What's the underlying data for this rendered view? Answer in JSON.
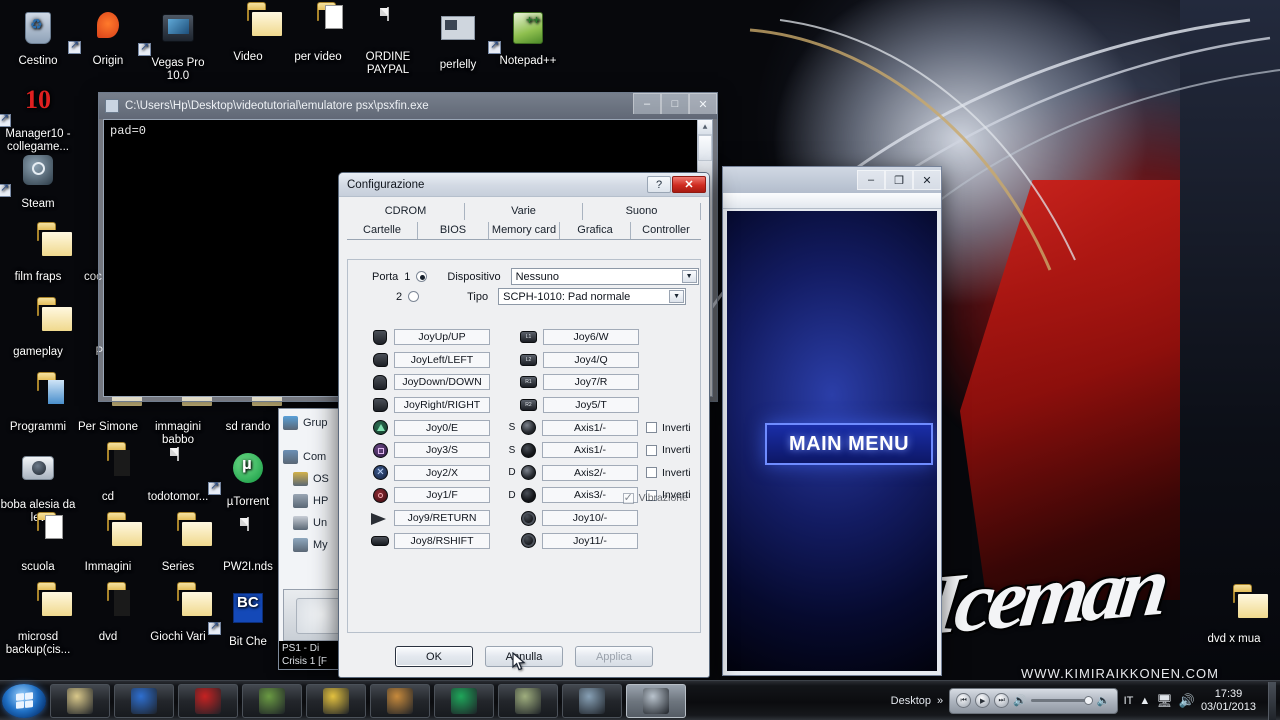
{
  "desktop": {
    "icons": [
      {
        "label": "Cestino",
        "type": "recycle"
      },
      {
        "label": "Origin",
        "type": "origin"
      },
      {
        "label": "Vegas Pro 10.0",
        "type": "vegas"
      },
      {
        "label": "Video",
        "type": "folder"
      },
      {
        "label": "per video",
        "type": "folder-doc"
      },
      {
        "label": "ORDINE PAYPAL",
        "type": "paper"
      },
      {
        "label": "perlelly",
        "type": "image"
      },
      {
        "label": "Notepad++",
        "type": "notepadpp"
      },
      {
        "label": "Manager10 - collegame...",
        "type": "manager10"
      },
      {
        "label": "Steam",
        "type": "steam"
      },
      {
        "label": "film fraps",
        "type": "folder"
      },
      {
        "label": "coc... coll",
        "type": "folder"
      },
      {
        "label": "gameplay",
        "type": "folder"
      },
      {
        "label": "PRO",
        "type": "folder"
      },
      {
        "label": "Programmi",
        "type": "folder-blue"
      },
      {
        "label": "Per Simone",
        "type": "folder"
      },
      {
        "label": "immagini babbo",
        "type": "folder"
      },
      {
        "label": "sd rando",
        "type": "folder"
      },
      {
        "label": "boba alesia da lev",
        "type": "camera"
      },
      {
        "label": "cd",
        "type": "folder-blk"
      },
      {
        "label": "todotomor...",
        "type": "paper"
      },
      {
        "label": "µTorrent",
        "type": "utorrent"
      },
      {
        "label": "scuola",
        "type": "folder-doc"
      },
      {
        "label": "Immagini",
        "type": "folder"
      },
      {
        "label": "Series",
        "type": "folder"
      },
      {
        "label": "PW2I.nds",
        "type": "paper"
      },
      {
        "label": "microsd backup(cis...",
        "type": "folder"
      },
      {
        "label": "dvd",
        "type": "folder-blk"
      },
      {
        "label": "Giochi Vari",
        "type": "folder"
      },
      {
        "label": "Bit Che",
        "type": "bitche"
      },
      {
        "label": "dvd x mua",
        "type": "folder"
      }
    ]
  },
  "wallpaper": {
    "brand_script": "Iceman",
    "url_text": "WWW.KIMIRAIKKONEN.COM"
  },
  "console_window": {
    "title": "C:\\Users\\Hp\\Desktop\\videotutorial\\emulatore psx\\psxfin.exe",
    "output": "pad=0",
    "minimize_label": "–",
    "maximize_label": "□",
    "close_label": "✕"
  },
  "explorer_window": {
    "items": [
      {
        "label": "Grup"
      },
      {
        "label": "Com"
      },
      {
        "label": "OS"
      },
      {
        "label": "HP"
      },
      {
        "label": "Un"
      },
      {
        "label": "My"
      }
    ],
    "caption_line1": "PS1 - Di",
    "caption_line2": "Crisis 1 [F"
  },
  "game_window": {
    "minimize_label": "–",
    "maximize_label": "❐",
    "close_label": "✕",
    "main_menu_text": "MAIN MENU"
  },
  "config_dialog": {
    "title": "Configurazione",
    "help_label": "?",
    "close_label": "✕",
    "tabs_row1": [
      "CDROM",
      "Varie",
      "Suono"
    ],
    "tabs_row2": [
      "Cartelle",
      "BIOS",
      "Memory card",
      "Grafica",
      "Controller"
    ],
    "active_tab": "Controller",
    "port": {
      "label": "Porta",
      "option1": "1",
      "option2": "2",
      "selected": "1"
    },
    "device": {
      "label": "Dispositivo",
      "value": "Nessuno"
    },
    "type": {
      "label": "Tipo",
      "value": "SCPH-1010: Pad normale"
    },
    "bindings_left": [
      {
        "icon": "dpad-up-icon",
        "value": "JoyUp/UP"
      },
      {
        "icon": "dpad-left-icon",
        "value": "JoyLeft/LEFT"
      },
      {
        "icon": "dpad-down-icon",
        "value": "JoyDown/DOWN"
      },
      {
        "icon": "dpad-right-icon",
        "value": "JoyRight/RIGHT"
      },
      {
        "icon": "triangle-icon",
        "value": "Joy0/E"
      },
      {
        "icon": "square-icon",
        "value": "Joy3/S"
      },
      {
        "icon": "cross-icon",
        "value": "Joy2/X"
      },
      {
        "icon": "circle-icon",
        "value": "Joy1/F"
      },
      {
        "icon": "start-icon",
        "value": "Joy9/RETURN"
      },
      {
        "icon": "select-icon",
        "value": "Joy8/RSHIFT"
      }
    ],
    "bindings_right": [
      {
        "icon": "l1-icon",
        "value": "Joy6/W",
        "prefix": "",
        "invert": null
      },
      {
        "icon": "l2-icon",
        "value": "Joy4/Q",
        "prefix": "",
        "invert": null
      },
      {
        "icon": "r1-icon",
        "value": "Joy7/R",
        "prefix": "",
        "invert": null
      },
      {
        "icon": "r2-icon",
        "value": "Joy5/T",
        "prefix": "",
        "invert": null
      },
      {
        "icon": "stick-light-icon",
        "value": "Axis1/-",
        "prefix": "S",
        "invert": false,
        "invert_label": "Inverti"
      },
      {
        "icon": "stick-dark-icon",
        "value": "Axis1/-",
        "prefix": "S",
        "invert": false,
        "invert_label": "Inverti"
      },
      {
        "icon": "stick-light-icon",
        "value": "Axis2/-",
        "prefix": "D",
        "invert": false,
        "invert_label": "Inverti"
      },
      {
        "icon": "stick-dark-icon",
        "value": "Axis3/-",
        "prefix": "D",
        "invert": false,
        "invert_label": "Inverti"
      },
      {
        "icon": "l3-icon",
        "value": "Joy10/-",
        "prefix": "",
        "invert": null
      },
      {
        "icon": "r3-icon",
        "value": "Joy11/-",
        "prefix": "",
        "invert": null
      }
    ],
    "vibration": {
      "label": "Vibrazione",
      "checked": true,
      "enabled": false
    },
    "buttons": {
      "ok": "OK",
      "cancel": "Annulla",
      "apply": "Applica",
      "apply_enabled": false
    }
  },
  "taskbar": {
    "start_label": "Start",
    "tasks": [
      {
        "name": "windows-explorer",
        "color": "#d9c88a"
      },
      {
        "name": "media-player",
        "color": "#2e6fd0"
      },
      {
        "name": "r-game",
        "color": "#c62222"
      },
      {
        "name": "minecraft",
        "color": "#6a9a43"
      },
      {
        "name": "pes",
        "color": "#e3c13f"
      },
      {
        "name": "ares",
        "color": "#c78a3c"
      },
      {
        "name": "google-chrome",
        "color": "#1fa65a"
      },
      {
        "name": "picture-viewer",
        "color": "#9fae7e"
      },
      {
        "name": "paint-app",
        "color": "#87a0b5"
      },
      {
        "name": "psx-emulator",
        "color": "#b9c3cd"
      }
    ],
    "show_desktop_label": "Desktop",
    "overflow_label": "»",
    "media": {
      "prev_label": "⏮",
      "play_label": "▶",
      "next_label": "⏭"
    },
    "language": "IT",
    "time": "17:39",
    "date": "03/01/2013"
  }
}
